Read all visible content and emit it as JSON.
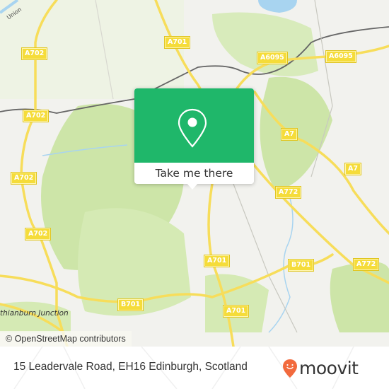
{
  "map": {
    "road_labels": [
      {
        "id": "a701-top",
        "text": "A701"
      },
      {
        "id": "a702-nw",
        "text": "A702"
      },
      {
        "id": "a702-w",
        "text": "A702"
      },
      {
        "id": "a702-sw1",
        "text": "A702"
      },
      {
        "id": "a702-sw2",
        "text": "A702"
      },
      {
        "id": "a6095-1",
        "text": "A6095"
      },
      {
        "id": "a6095-2",
        "text": "A6095"
      },
      {
        "id": "a7-1",
        "text": "A7"
      },
      {
        "id": "a7-2",
        "text": "A7"
      },
      {
        "id": "a772-1",
        "text": "A772"
      },
      {
        "id": "a772-2",
        "text": "A772"
      },
      {
        "id": "a701-mid",
        "text": "A701"
      },
      {
        "id": "a701-low",
        "text": "A701"
      },
      {
        "id": "b701-w",
        "text": "B701"
      },
      {
        "id": "b701-e",
        "text": "B701"
      }
    ],
    "place_labels": {
      "junction": "thianburn Junction",
      "union_canal": "Union"
    },
    "attribution": "© OpenStreetMap contributors",
    "colors": {
      "background": "#f2f2ee",
      "green_area": "#cde5a8",
      "road_major": "#f7dd5a",
      "railway": "#666666",
      "water": "#a8d4f0"
    }
  },
  "popup": {
    "icon": "map-pin-icon",
    "button_label": "Take me there",
    "accent_color": "#1fb76a"
  },
  "footer": {
    "address": "15 Leadervale Road, EH16 Edinburgh, Scotland",
    "brand": "moovit",
    "brand_icon": "moovit-pin-smile-icon",
    "brand_color": "#f26a3d"
  }
}
